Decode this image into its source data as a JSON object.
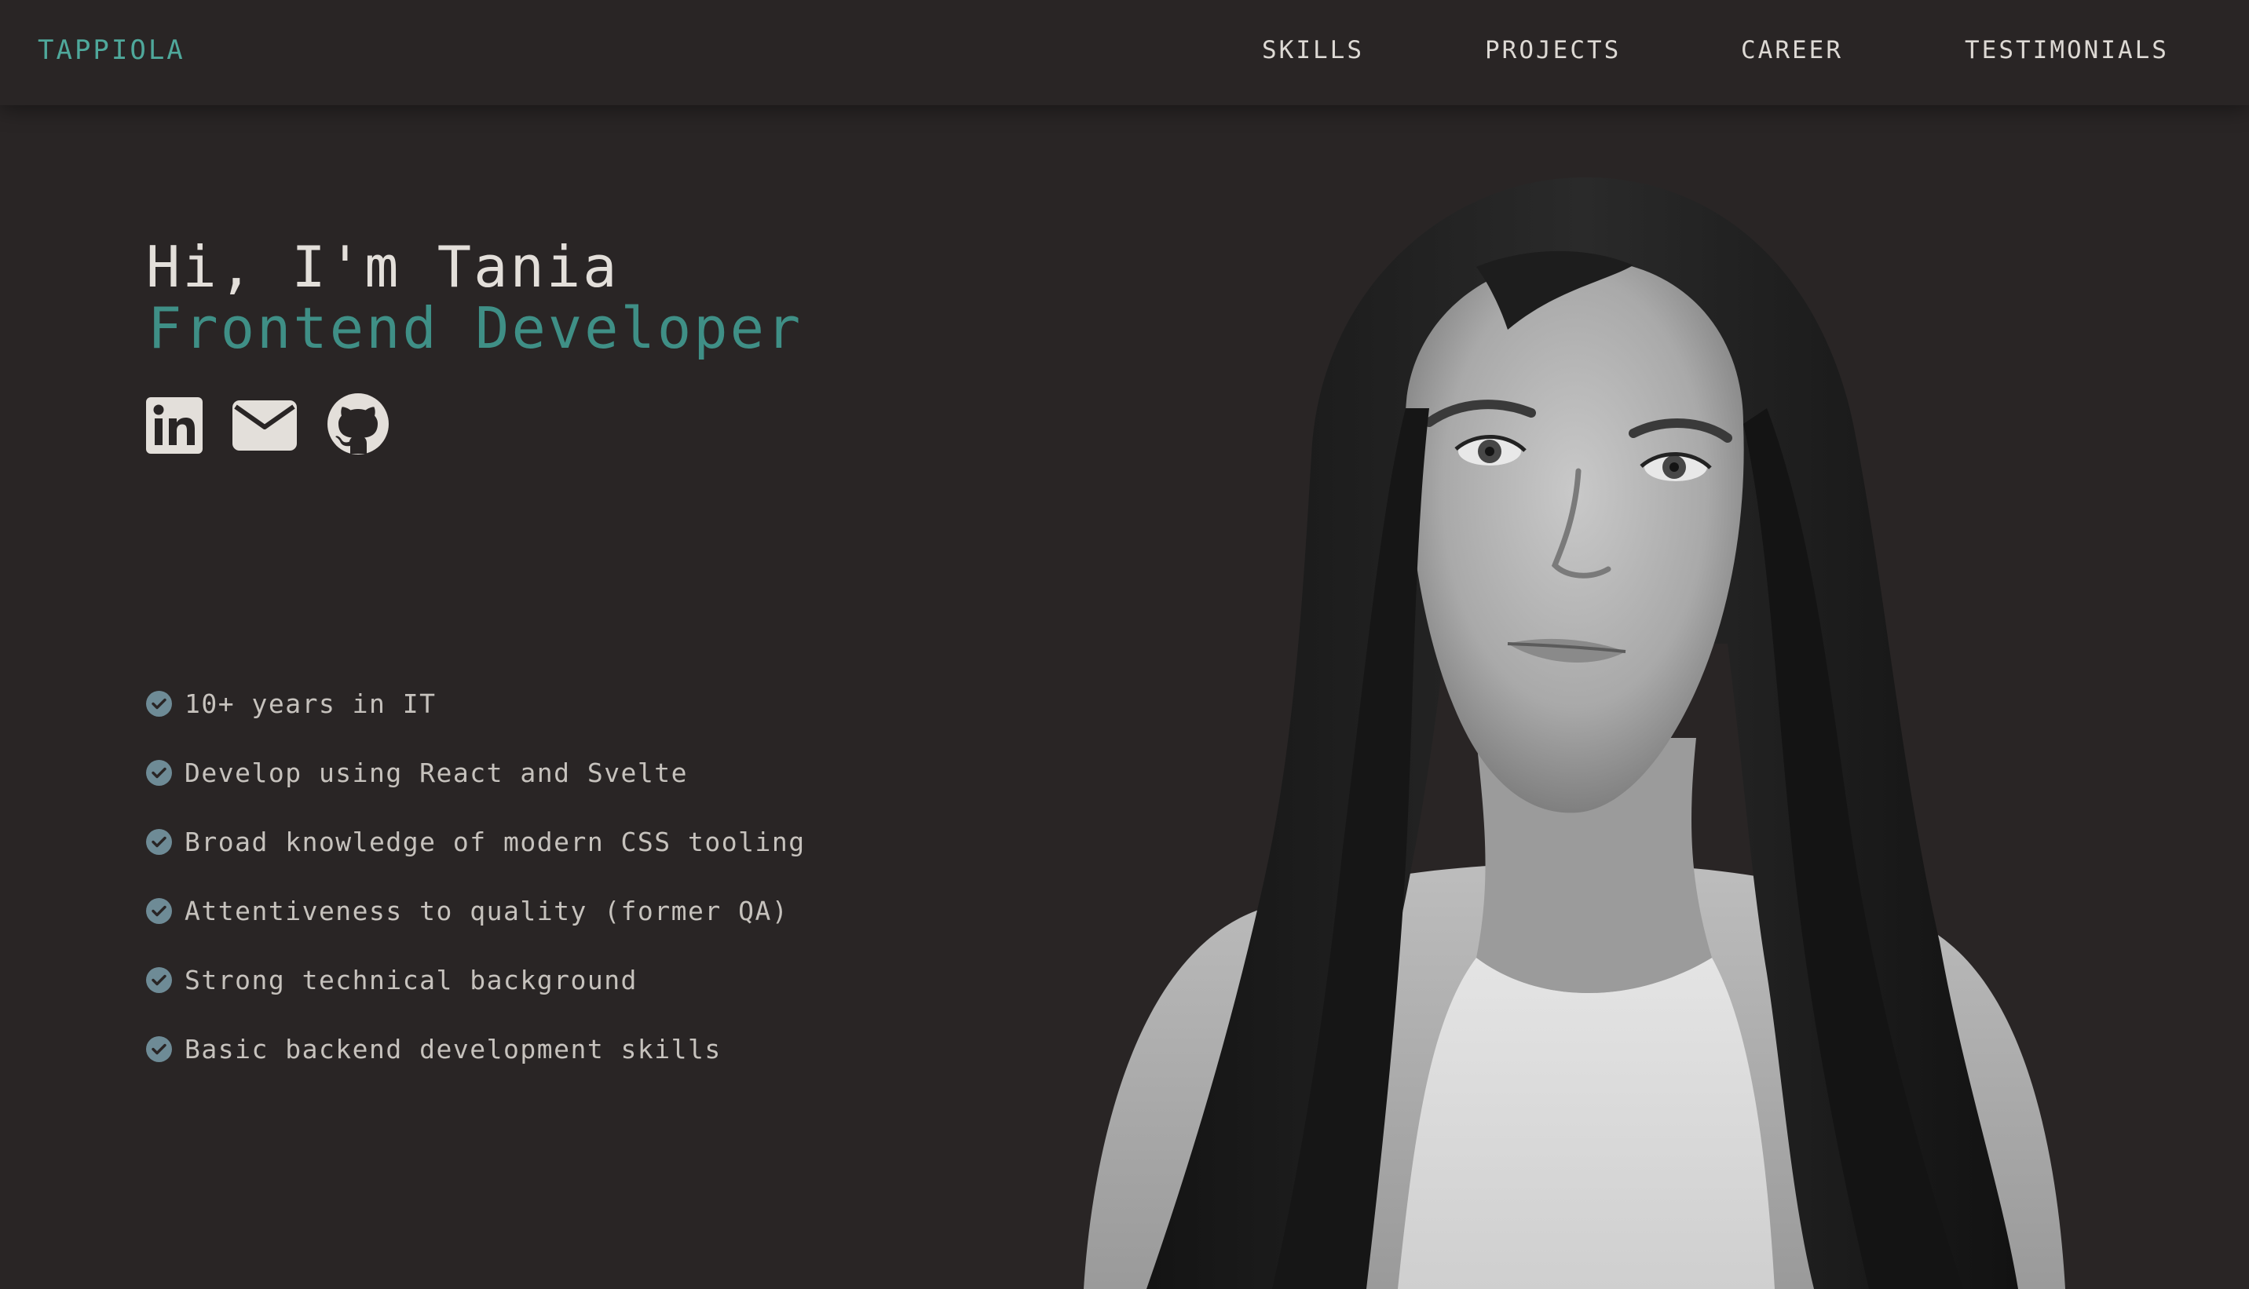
{
  "header": {
    "logo": "TAPPIOLA",
    "nav": [
      {
        "label": "SKILLS"
      },
      {
        "label": "PROJECTS"
      },
      {
        "label": "CAREER"
      },
      {
        "label": "TESTIMONIALS"
      }
    ]
  },
  "hero": {
    "greeting": "Hi, I'm Tania",
    "role": "Frontend Developer",
    "socials": [
      {
        "icon": "linkedin-icon"
      },
      {
        "icon": "mail-icon"
      },
      {
        "icon": "github-icon"
      }
    ],
    "highlights": [
      "10+ years in IT",
      "Develop using React and Svelte",
      "Broad knowledge of modern CSS tooling",
      "Attentiveness to quality (former QA)",
      "Strong technical background",
      "Basic backend development skills"
    ]
  },
  "colors": {
    "background": "#292525",
    "accent": "#4fa89b",
    "role_text": "#3f8f86",
    "check_badge": "#6e8b96",
    "nav_text": "#ddd9d4"
  }
}
